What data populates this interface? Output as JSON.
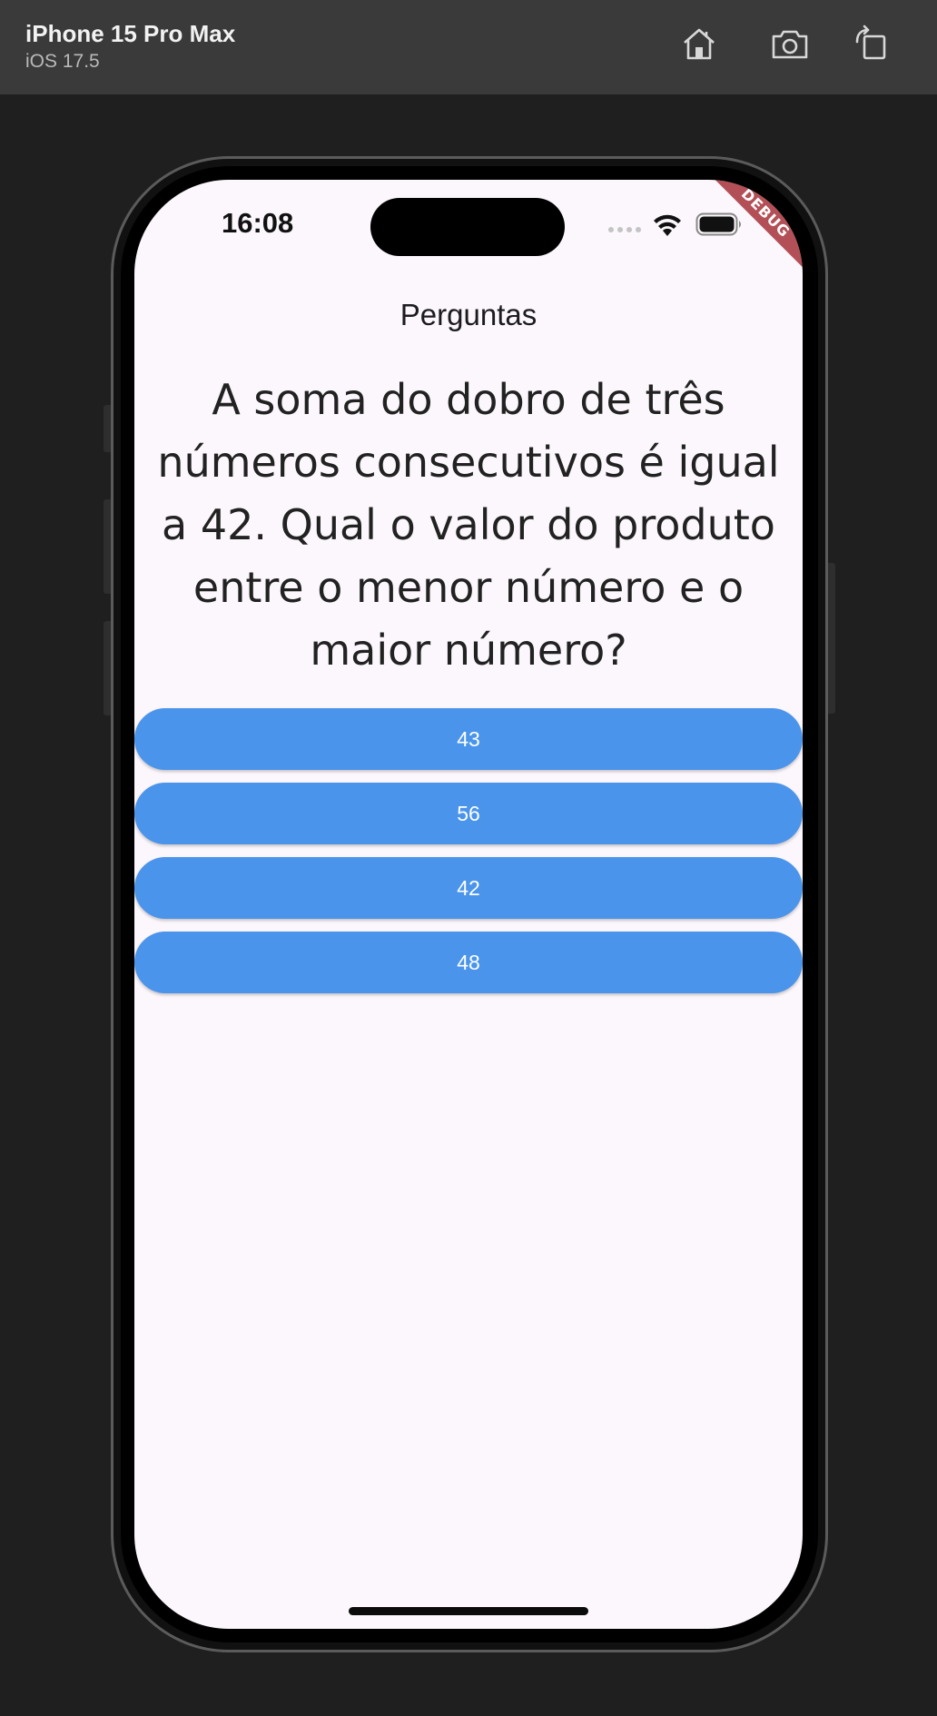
{
  "simulator": {
    "device_name": "iPhone 15 Pro Max",
    "os_version": "iOS 17.5",
    "toolbar_icons": [
      "home-icon",
      "screenshot-icon",
      "rotate-icon"
    ]
  },
  "status_bar": {
    "time": "16:08",
    "debug_label": "DEBUG"
  },
  "app": {
    "title": "Perguntas",
    "question": "A soma do dobro de três números consecutivos é igual a 42. Qual o valor do produto entre o menor número e o maior número?",
    "answers": [
      "43",
      "56",
      "42",
      "48"
    ],
    "colors": {
      "background": "#fcf7fc",
      "answer_button": "#4a94eb",
      "answer_text": "#ffffff"
    }
  }
}
